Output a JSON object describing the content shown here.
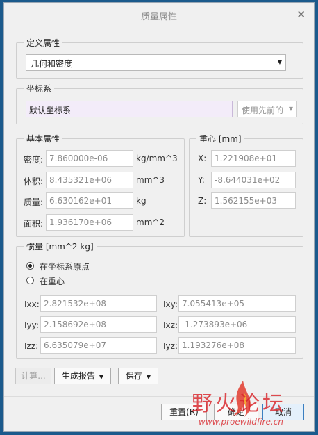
{
  "dialog": {
    "title": "质量属性",
    "close": "×"
  },
  "define": {
    "legend": "定义属性",
    "selected": "几何和密度"
  },
  "coord": {
    "legend": "坐标系",
    "value": "默认坐标系",
    "use_prev": "使用先前的"
  },
  "basic": {
    "legend": "基本属性",
    "rows": [
      {
        "label": "密度:",
        "value": "7.860000e-06",
        "unit": "kg/mm^3"
      },
      {
        "label": "体积:",
        "value": "8.435321e+06",
        "unit": "mm^3"
      },
      {
        "label": "质量:",
        "value": "6.630162e+01",
        "unit": "kg"
      },
      {
        "label": "面积:",
        "value": "1.936170e+06",
        "unit": "mm^2"
      }
    ]
  },
  "center": {
    "legend": "重心 [mm]",
    "rows": [
      {
        "label": "X:",
        "value": "1.221908e+01"
      },
      {
        "label": "Y:",
        "value": "-8.644031e+02"
      },
      {
        "label": "Z:",
        "value": "1.562155e+03"
      }
    ]
  },
  "inertia": {
    "legend": "惯量 [mm^2 kg]",
    "radio_origin": "在坐标系原点",
    "radio_center": "在重心",
    "fields": [
      {
        "label": "Ixx:",
        "value": "2.821532e+08"
      },
      {
        "label": "Ixy:",
        "value": "7.055413e+05"
      },
      {
        "label": "Iyy:",
        "value": "2.158692e+08"
      },
      {
        "label": "Ixz:",
        "value": "-1.273893e+06"
      },
      {
        "label": "Izz:",
        "value": "6.635079e+07"
      },
      {
        "label": "Iyz:",
        "value": "1.193276e+08"
      }
    ]
  },
  "actions": {
    "compute": "计算...",
    "report": "生成报告",
    "save": "保存"
  },
  "footer": {
    "reset": "重置(R)",
    "ok": "确定",
    "cancel": "取消"
  },
  "watermark": {
    "text": "野火论坛",
    "url": "www.proewildfire.cn"
  },
  "colors": {
    "accent": "#1b5a8c",
    "watermark_red": "#d9262b",
    "highlight": "#f3ecf9"
  }
}
